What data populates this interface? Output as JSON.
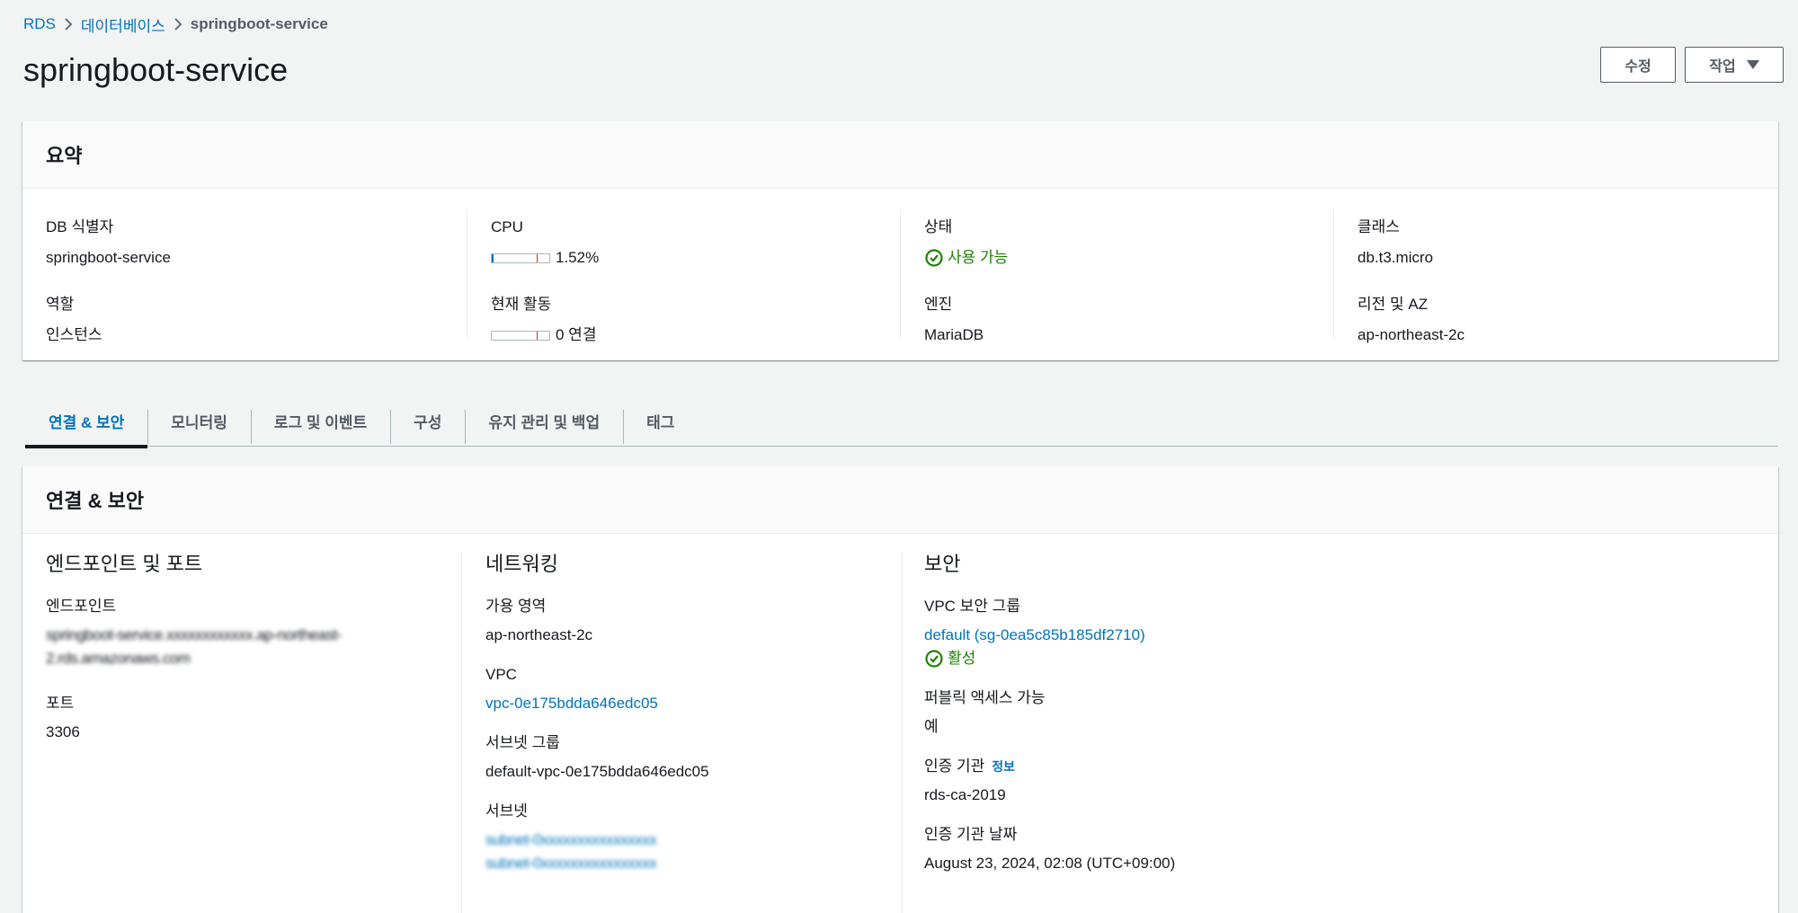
{
  "breadcrumb": {
    "root": "RDS",
    "parent": "데이터베이스",
    "current": "springboot-service"
  },
  "page_title": "springboot-service",
  "header_buttons": {
    "edit": "수정",
    "actions": "작업"
  },
  "summary": {
    "title": "요약",
    "db_id_label": "DB 식별자",
    "db_id_value": "springboot-service",
    "role_label": "역할",
    "role_value": "인스턴스",
    "cpu_label": "CPU",
    "cpu_value": "1.52%",
    "cpu_fraction": 0.0152,
    "activity_label": "현재 활동",
    "activity_value": "0 연결",
    "status_label": "상태",
    "status_value": "사용 가능",
    "engine_label": "엔진",
    "engine_value": "MariaDB",
    "class_label": "클래스",
    "class_value": "db.t3.micro",
    "region_label": "리전 및 AZ",
    "region_value": "ap-northeast-2c"
  },
  "tabs": [
    {
      "label": "연결 & 보안",
      "active": true
    },
    {
      "label": "모니터링",
      "active": false
    },
    {
      "label": "로그 및 이벤트",
      "active": false
    },
    {
      "label": "구성",
      "active": false
    },
    {
      "label": "유지 관리 및 백업",
      "active": false
    },
    {
      "label": "태그",
      "active": false
    }
  ],
  "connectivity": {
    "title": "연결 & 보안",
    "endpoint_section": {
      "title": "엔드포인트 및 포트",
      "endpoint_label": "엔드포인트",
      "endpoint_line1": "springboot-service.xxxxxxxxxxxx.ap-northeast-",
      "endpoint_line2": "2.rds.amazonaws.com",
      "port_label": "포트",
      "port_value": "3306"
    },
    "networking_section": {
      "title": "네트워킹",
      "az_label": "가용 영역",
      "az_value": "ap-northeast-2c",
      "vpc_label": "VPC",
      "vpc_value": "vpc-0e175bdda646edc05",
      "subnet_group_label": "서브넷 그룹",
      "subnet_group_value": "default-vpc-0e175bdda646edc05",
      "subnets_label": "서브넷",
      "subnet_1": "subnet-0xxxxxxxxxxxxxxxx",
      "subnet_2": "subnet-0xxxxxxxxxxxxxxxx"
    },
    "security_section": {
      "title": "보안",
      "vpc_sg_label": "VPC 보안 그룹",
      "vpc_sg_value": "default (sg-0ea5c85b185df2710)",
      "sg_status": "활성",
      "public_access_label": "퍼블릭 액세스 가능",
      "public_access_value": "예",
      "ca_label": "인증 기관",
      "ca_info": "정보",
      "ca_value": "rds-ca-2019",
      "ca_date_label": "인증 기관 날짜",
      "ca_date_value": "August 23, 2024, 02:08 (UTC+09:00)"
    }
  },
  "colors": {
    "link": "#0073bb",
    "success": "#1d8102",
    "text": "#16191f",
    "muted": "#545b64"
  }
}
